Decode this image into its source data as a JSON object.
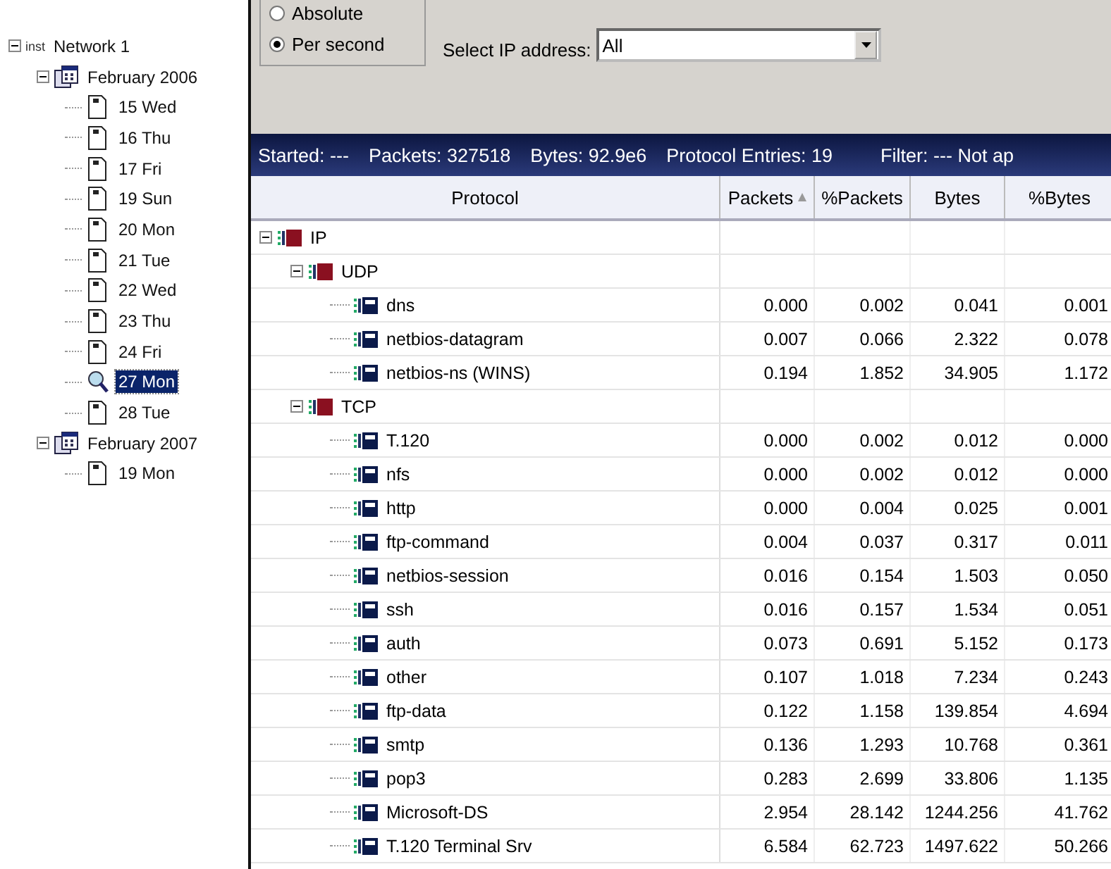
{
  "tree": [
    {
      "prefix": "inst",
      "label": "Network 1",
      "expanded": true,
      "selected": false,
      "children": [
        {
          "label": "February 2006",
          "expanded": true,
          "selected": false,
          "children": [
            {
              "label": "15 Wed",
              "selected": false
            },
            {
              "label": "16 Thu",
              "selected": false
            },
            {
              "label": "17 Fri",
              "selected": false
            },
            {
              "label": "19 Sun",
              "selected": false
            },
            {
              "label": "20 Mon",
              "selected": false
            },
            {
              "label": "21 Tue",
              "selected": false
            },
            {
              "label": "22 Wed",
              "selected": false
            },
            {
              "label": "23 Thu",
              "selected": false
            },
            {
              "label": "24 Fri",
              "selected": false
            },
            {
              "label": "27 Mon",
              "selected": true
            },
            {
              "label": "28 Tue",
              "selected": false
            }
          ]
        },
        {
          "label": "February 2007",
          "expanded": true,
          "selected": false,
          "children": [
            {
              "label": "19 Mon",
              "selected": false
            }
          ]
        }
      ]
    }
  ],
  "mode": [
    {
      "label": "Absolute",
      "selected": false
    },
    {
      "label": "Per second",
      "selected": true
    }
  ],
  "ip_select": {
    "label": "Select IP address:",
    "value": "All"
  },
  "summary": [
    "Started: ---",
    "Packets: 327518",
    "Bytes: 92.9e6",
    "Protocol Entries: 19",
    "Filter: --- Not ap"
  ],
  "table": {
    "columns": [
      {
        "label": "Protocol",
        "sorted": false
      },
      {
        "label": "Packets",
        "sorted": true
      },
      {
        "label": "%Packets",
        "sorted": false
      },
      {
        "label": "Bytes",
        "sorted": false
      },
      {
        "label": "%Bytes",
        "sorted": false
      }
    ],
    "rows": [
      {
        "name": "IP",
        "expanded": true,
        "children": [
          {
            "name": "UDP",
            "expanded": true,
            "children": [
              {
                "name": "dns",
                "values": [
                  "0.000",
                  "0.002",
                  "0.041",
                  "0.001"
                ]
              },
              {
                "name": "netbios-datagram",
                "values": [
                  "0.007",
                  "0.066",
                  "2.322",
                  "0.078"
                ]
              },
              {
                "name": "netbios-ns (WINS)",
                "values": [
                  "0.194",
                  "1.852",
                  "34.905",
                  "1.172"
                ]
              }
            ]
          },
          {
            "name": "TCP",
            "expanded": true,
            "children": [
              {
                "name": "T.120",
                "values": [
                  "0.000",
                  "0.002",
                  "0.012",
                  "0.000"
                ]
              },
              {
                "name": "nfs",
                "values": [
                  "0.000",
                  "0.002",
                  "0.012",
                  "0.000"
                ]
              },
              {
                "name": "http",
                "values": [
                  "0.000",
                  "0.004",
                  "0.025",
                  "0.001"
                ]
              },
              {
                "name": "ftp-command",
                "values": [
                  "0.004",
                  "0.037",
                  "0.317",
                  "0.011"
                ]
              },
              {
                "name": "netbios-session",
                "values": [
                  "0.016",
                  "0.154",
                  "1.503",
                  "0.050"
                ]
              },
              {
                "name": "ssh",
                "values": [
                  "0.016",
                  "0.157",
                  "1.534",
                  "0.051"
                ]
              },
              {
                "name": "auth",
                "values": [
                  "0.073",
                  "0.691",
                  "5.152",
                  "0.173"
                ]
              },
              {
                "name": "other",
                "values": [
                  "0.107",
                  "1.018",
                  "7.234",
                  "0.243"
                ]
              },
              {
                "name": "ftp-data",
                "values": [
                  "0.122",
                  "1.158",
                  "139.854",
                  "4.694"
                ]
              },
              {
                "name": "smtp",
                "values": [
                  "0.136",
                  "1.293",
                  "10.768",
                  "0.361"
                ]
              },
              {
                "name": "pop3",
                "values": [
                  "0.283",
                  "2.699",
                  "33.806",
                  "1.135"
                ]
              },
              {
                "name": "Microsoft-DS",
                "values": [
                  "2.954",
                  "28.142",
                  "1244.256",
                  "41.762"
                ]
              },
              {
                "name": "T.120 Terminal Srv",
                "values": [
                  "6.584",
                  "62.723",
                  "1497.622",
                  "50.266"
                ]
              }
            ]
          }
        ]
      }
    ]
  }
}
